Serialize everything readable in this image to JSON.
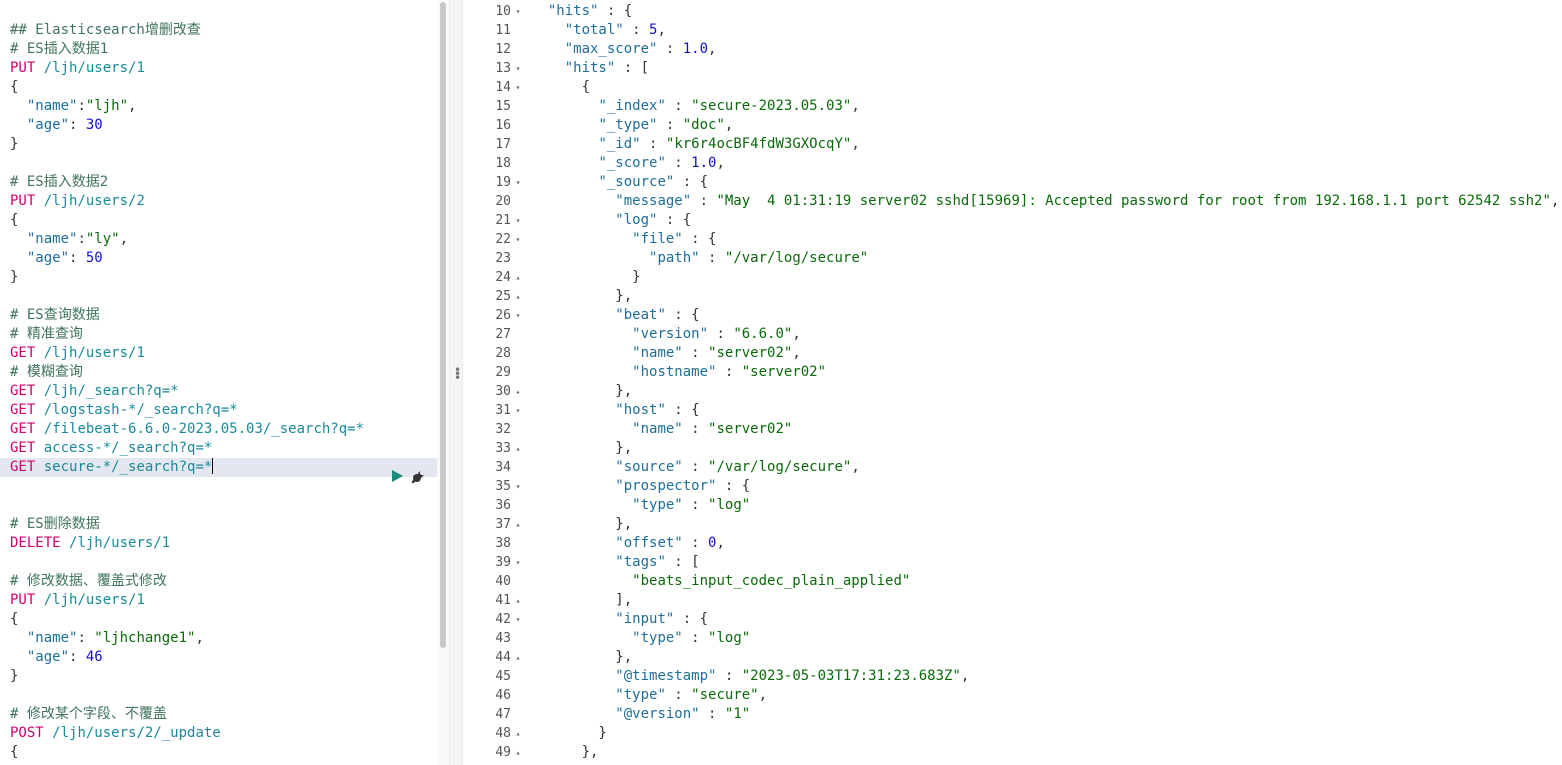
{
  "request_editor": {
    "active_line": 24,
    "lines": [
      [],
      [
        [
          "t-comment",
          "## Elasticsearch增删改查"
        ]
      ],
      [
        [
          "t-comment",
          "# ES插入数据1"
        ]
      ],
      [
        [
          "t-method",
          "PUT"
        ],
        [
          "t-punc",
          " "
        ],
        [
          "t-url",
          "/ljh/users/1"
        ]
      ],
      [
        [
          "t-punc",
          "{"
        ]
      ],
      [
        [
          "t-punc",
          "  "
        ],
        [
          "t-key",
          "\"name\""
        ],
        [
          "t-punc",
          ":"
        ],
        [
          "t-str",
          "\"ljh\""
        ],
        [
          "t-punc",
          ","
        ]
      ],
      [
        [
          "t-punc",
          "  "
        ],
        [
          "t-key",
          "\"age\""
        ],
        [
          "t-punc",
          ": "
        ],
        [
          "t-num",
          "30"
        ]
      ],
      [
        [
          "t-punc",
          "}"
        ]
      ],
      [],
      [
        [
          "t-comment",
          "# ES插入数据2"
        ]
      ],
      [
        [
          "t-method",
          "PUT"
        ],
        [
          "t-punc",
          " "
        ],
        [
          "t-url",
          "/ljh/users/2"
        ]
      ],
      [
        [
          "t-punc",
          "{"
        ]
      ],
      [
        [
          "t-punc",
          "  "
        ],
        [
          "t-key",
          "\"name\""
        ],
        [
          "t-punc",
          ":"
        ],
        [
          "t-str",
          "\"ly\""
        ],
        [
          "t-punc",
          ","
        ]
      ],
      [
        [
          "t-punc",
          "  "
        ],
        [
          "t-key",
          "\"age\""
        ],
        [
          "t-punc",
          ": "
        ],
        [
          "t-num",
          "50"
        ]
      ],
      [
        [
          "t-punc",
          "}"
        ]
      ],
      [],
      [
        [
          "t-comment",
          "# ES查询数据"
        ]
      ],
      [
        [
          "t-comment",
          "# 精准查询"
        ]
      ],
      [
        [
          "t-method",
          "GET"
        ],
        [
          "t-punc",
          " "
        ],
        [
          "t-url",
          "/ljh/users/1"
        ]
      ],
      [
        [
          "t-comment",
          "# 模糊查询"
        ]
      ],
      [
        [
          "t-method",
          "GET"
        ],
        [
          "t-punc",
          " "
        ],
        [
          "t-url",
          "/ljh/_search?q=*"
        ]
      ],
      [
        [
          "t-method",
          "GET"
        ],
        [
          "t-punc",
          " "
        ],
        [
          "t-url",
          "/logstash-*/_search?q=*"
        ]
      ],
      [
        [
          "t-method",
          "GET"
        ],
        [
          "t-punc",
          " "
        ],
        [
          "t-url",
          "/filebeat-6.6.0-2023.05.03/_search?q=*"
        ]
      ],
      [
        [
          "t-method",
          "GET"
        ],
        [
          "t-punc",
          " "
        ],
        [
          "t-url",
          "access-*/_search?q=*"
        ]
      ],
      [
        [
          "t-method",
          "GET"
        ],
        [
          "t-punc",
          " "
        ],
        [
          "t-url",
          "secure-*/_search?q=*"
        ]
      ],
      [],
      [],
      [
        [
          "t-comment",
          "# ES删除数据"
        ]
      ],
      [
        [
          "t-method",
          "DELETE"
        ],
        [
          "t-punc",
          " "
        ],
        [
          "t-url",
          "/ljh/users/1"
        ]
      ],
      [],
      [
        [
          "t-comment",
          "# 修改数据、覆盖式修改"
        ]
      ],
      [
        [
          "t-method",
          "PUT"
        ],
        [
          "t-punc",
          " "
        ],
        [
          "t-url",
          "/ljh/users/1"
        ]
      ],
      [
        [
          "t-punc",
          "{"
        ]
      ],
      [
        [
          "t-punc",
          "  "
        ],
        [
          "t-key",
          "\"name\""
        ],
        [
          "t-punc",
          ": "
        ],
        [
          "t-str",
          "\"ljhchange1\""
        ],
        [
          "t-punc",
          ","
        ]
      ],
      [
        [
          "t-punc",
          "  "
        ],
        [
          "t-key",
          "\"age\""
        ],
        [
          "t-punc",
          ": "
        ],
        [
          "t-num",
          "46"
        ]
      ],
      [
        [
          "t-punc",
          "}"
        ]
      ],
      [],
      [
        [
          "t-comment",
          "# 修改某个字段、不覆盖"
        ]
      ],
      [
        [
          "t-method",
          "POST"
        ],
        [
          "t-punc",
          " "
        ],
        [
          "t-url",
          "/ljh/users/2/_update"
        ]
      ],
      [
        [
          "t-punc",
          "{"
        ]
      ]
    ]
  },
  "response_viewer": {
    "lines": [
      {
        "n": "10",
        "fold": "▾",
        "code": [
          [
            "t-punc",
            "  "
          ],
          [
            "t-key",
            "\"hits\""
          ],
          [
            "t-punc",
            " : {"
          ]
        ]
      },
      {
        "n": "11",
        "fold": "",
        "code": [
          [
            "t-punc",
            "    "
          ],
          [
            "t-key",
            "\"total\""
          ],
          [
            "t-punc",
            " : "
          ],
          [
            "t-num",
            "5"
          ],
          [
            "t-punc",
            ","
          ]
        ]
      },
      {
        "n": "12",
        "fold": "",
        "code": [
          [
            "t-punc",
            "    "
          ],
          [
            "t-key",
            "\"max_score\""
          ],
          [
            "t-punc",
            " : "
          ],
          [
            "t-num",
            "1.0"
          ],
          [
            "t-punc",
            ","
          ]
        ]
      },
      {
        "n": "13",
        "fold": "▾",
        "code": [
          [
            "t-punc",
            "    "
          ],
          [
            "t-key",
            "\"hits\""
          ],
          [
            "t-punc",
            " : ["
          ]
        ]
      },
      {
        "n": "14",
        "fold": "▾",
        "code": [
          [
            "t-punc",
            "      {"
          ]
        ]
      },
      {
        "n": "15",
        "fold": "",
        "code": [
          [
            "t-punc",
            "        "
          ],
          [
            "t-key",
            "\"_index\""
          ],
          [
            "t-punc",
            " : "
          ],
          [
            "t-str",
            "\"secure-2023.05.03\""
          ],
          [
            "t-punc",
            ","
          ]
        ]
      },
      {
        "n": "16",
        "fold": "",
        "code": [
          [
            "t-punc",
            "        "
          ],
          [
            "t-key",
            "\"_type\""
          ],
          [
            "t-punc",
            " : "
          ],
          [
            "t-str",
            "\"doc\""
          ],
          [
            "t-punc",
            ","
          ]
        ]
      },
      {
        "n": "17",
        "fold": "",
        "code": [
          [
            "t-punc",
            "        "
          ],
          [
            "t-key",
            "\"_id\""
          ],
          [
            "t-punc",
            " : "
          ],
          [
            "t-str",
            "\"kr6r4ocBF4fdW3GXOcqY\""
          ],
          [
            "t-punc",
            ","
          ]
        ]
      },
      {
        "n": "18",
        "fold": "",
        "code": [
          [
            "t-punc",
            "        "
          ],
          [
            "t-key",
            "\"_score\""
          ],
          [
            "t-punc",
            " : "
          ],
          [
            "t-num",
            "1.0"
          ],
          [
            "t-punc",
            ","
          ]
        ]
      },
      {
        "n": "19",
        "fold": "▾",
        "code": [
          [
            "t-punc",
            "        "
          ],
          [
            "t-key",
            "\"_source\""
          ],
          [
            "t-punc",
            " : {"
          ]
        ]
      },
      {
        "n": "20",
        "fold": "",
        "code": [
          [
            "t-punc",
            "          "
          ],
          [
            "t-key",
            "\"message\""
          ],
          [
            "t-punc",
            " : "
          ],
          [
            "t-str",
            "\"May  4 01:31:19 server02 sshd[15969]: Accepted password for root from 192.168.1.1 port 62542 ssh2\""
          ],
          [
            "t-punc",
            ","
          ]
        ]
      },
      {
        "n": "21",
        "fold": "▾",
        "code": [
          [
            "t-punc",
            "          "
          ],
          [
            "t-key",
            "\"log\""
          ],
          [
            "t-punc",
            " : {"
          ]
        ]
      },
      {
        "n": "22",
        "fold": "▾",
        "code": [
          [
            "t-punc",
            "            "
          ],
          [
            "t-key",
            "\"file\""
          ],
          [
            "t-punc",
            " : {"
          ]
        ]
      },
      {
        "n": "23",
        "fold": "",
        "code": [
          [
            "t-punc",
            "              "
          ],
          [
            "t-key",
            "\"path\""
          ],
          [
            "t-punc",
            " : "
          ],
          [
            "t-str",
            "\"/var/log/secure\""
          ]
        ]
      },
      {
        "n": "24",
        "fold": "▴",
        "code": [
          [
            "t-punc",
            "            }"
          ]
        ]
      },
      {
        "n": "25",
        "fold": "▴",
        "code": [
          [
            "t-punc",
            "          },"
          ]
        ]
      },
      {
        "n": "26",
        "fold": "▾",
        "code": [
          [
            "t-punc",
            "          "
          ],
          [
            "t-key",
            "\"beat\""
          ],
          [
            "t-punc",
            " : {"
          ]
        ]
      },
      {
        "n": "27",
        "fold": "",
        "code": [
          [
            "t-punc",
            "            "
          ],
          [
            "t-key",
            "\"version\""
          ],
          [
            "t-punc",
            " : "
          ],
          [
            "t-str",
            "\"6.6.0\""
          ],
          [
            "t-punc",
            ","
          ]
        ]
      },
      {
        "n": "28",
        "fold": "",
        "code": [
          [
            "t-punc",
            "            "
          ],
          [
            "t-key",
            "\"name\""
          ],
          [
            "t-punc",
            " : "
          ],
          [
            "t-str",
            "\"server02\""
          ],
          [
            "t-punc",
            ","
          ]
        ]
      },
      {
        "n": "29",
        "fold": "",
        "code": [
          [
            "t-punc",
            "            "
          ],
          [
            "t-key",
            "\"hostname\""
          ],
          [
            "t-punc",
            " : "
          ],
          [
            "t-str",
            "\"server02\""
          ]
        ]
      },
      {
        "n": "30",
        "fold": "▴",
        "code": [
          [
            "t-punc",
            "          },"
          ]
        ]
      },
      {
        "n": "31",
        "fold": "▾",
        "code": [
          [
            "t-punc",
            "          "
          ],
          [
            "t-key",
            "\"host\""
          ],
          [
            "t-punc",
            " : {"
          ]
        ]
      },
      {
        "n": "32",
        "fold": "",
        "code": [
          [
            "t-punc",
            "            "
          ],
          [
            "t-key",
            "\"name\""
          ],
          [
            "t-punc",
            " : "
          ],
          [
            "t-str",
            "\"server02\""
          ]
        ]
      },
      {
        "n": "33",
        "fold": "▴",
        "code": [
          [
            "t-punc",
            "          },"
          ]
        ]
      },
      {
        "n": "34",
        "fold": "",
        "code": [
          [
            "t-punc",
            "          "
          ],
          [
            "t-key",
            "\"source\""
          ],
          [
            "t-punc",
            " : "
          ],
          [
            "t-str",
            "\"/var/log/secure\""
          ],
          [
            "t-punc",
            ","
          ]
        ]
      },
      {
        "n": "35",
        "fold": "▾",
        "code": [
          [
            "t-punc",
            "          "
          ],
          [
            "t-key",
            "\"prospector\""
          ],
          [
            "t-punc",
            " : {"
          ]
        ]
      },
      {
        "n": "36",
        "fold": "",
        "code": [
          [
            "t-punc",
            "            "
          ],
          [
            "t-key",
            "\"type\""
          ],
          [
            "t-punc",
            " : "
          ],
          [
            "t-str",
            "\"log\""
          ]
        ]
      },
      {
        "n": "37",
        "fold": "▴",
        "code": [
          [
            "t-punc",
            "          },"
          ]
        ]
      },
      {
        "n": "38",
        "fold": "",
        "code": [
          [
            "t-punc",
            "          "
          ],
          [
            "t-key",
            "\"offset\""
          ],
          [
            "t-punc",
            " : "
          ],
          [
            "t-num",
            "0"
          ],
          [
            "t-punc",
            ","
          ]
        ]
      },
      {
        "n": "39",
        "fold": "▾",
        "code": [
          [
            "t-punc",
            "          "
          ],
          [
            "t-key",
            "\"tags\""
          ],
          [
            "t-punc",
            " : ["
          ]
        ]
      },
      {
        "n": "40",
        "fold": "",
        "code": [
          [
            "t-punc",
            "            "
          ],
          [
            "t-str",
            "\"beats_input_codec_plain_applied\""
          ]
        ]
      },
      {
        "n": "41",
        "fold": "▴",
        "code": [
          [
            "t-punc",
            "          ],"
          ]
        ]
      },
      {
        "n": "42",
        "fold": "▾",
        "code": [
          [
            "t-punc",
            "          "
          ],
          [
            "t-key",
            "\"input\""
          ],
          [
            "t-punc",
            " : {"
          ]
        ]
      },
      {
        "n": "43",
        "fold": "",
        "code": [
          [
            "t-punc",
            "            "
          ],
          [
            "t-key",
            "\"type\""
          ],
          [
            "t-punc",
            " : "
          ],
          [
            "t-str",
            "\"log\""
          ]
        ]
      },
      {
        "n": "44",
        "fold": "▴",
        "code": [
          [
            "t-punc",
            "          },"
          ]
        ]
      },
      {
        "n": "45",
        "fold": "",
        "code": [
          [
            "t-punc",
            "          "
          ],
          [
            "t-key",
            "\"@timestamp\""
          ],
          [
            "t-punc",
            " : "
          ],
          [
            "t-str",
            "\"2023-05-03T17:31:23.683Z\""
          ],
          [
            "t-punc",
            ","
          ]
        ]
      },
      {
        "n": "46",
        "fold": "",
        "code": [
          [
            "t-punc",
            "          "
          ],
          [
            "t-key",
            "\"type\""
          ],
          [
            "t-punc",
            " : "
          ],
          [
            "t-str",
            "\"secure\""
          ],
          [
            "t-punc",
            ","
          ]
        ]
      },
      {
        "n": "47",
        "fold": "",
        "code": [
          [
            "t-punc",
            "          "
          ],
          [
            "t-key",
            "\"@version\""
          ],
          [
            "t-punc",
            " : "
          ],
          [
            "t-str",
            "\"1\""
          ]
        ]
      },
      {
        "n": "48",
        "fold": "▴",
        "code": [
          [
            "t-punc",
            "        }"
          ]
        ]
      },
      {
        "n": "49",
        "fold": "▴",
        "code": [
          [
            "t-punc",
            "      },"
          ]
        ]
      }
    ]
  },
  "toolbar": {
    "play_icon": "play-icon",
    "wrench_icon": "wrench-icon"
  }
}
